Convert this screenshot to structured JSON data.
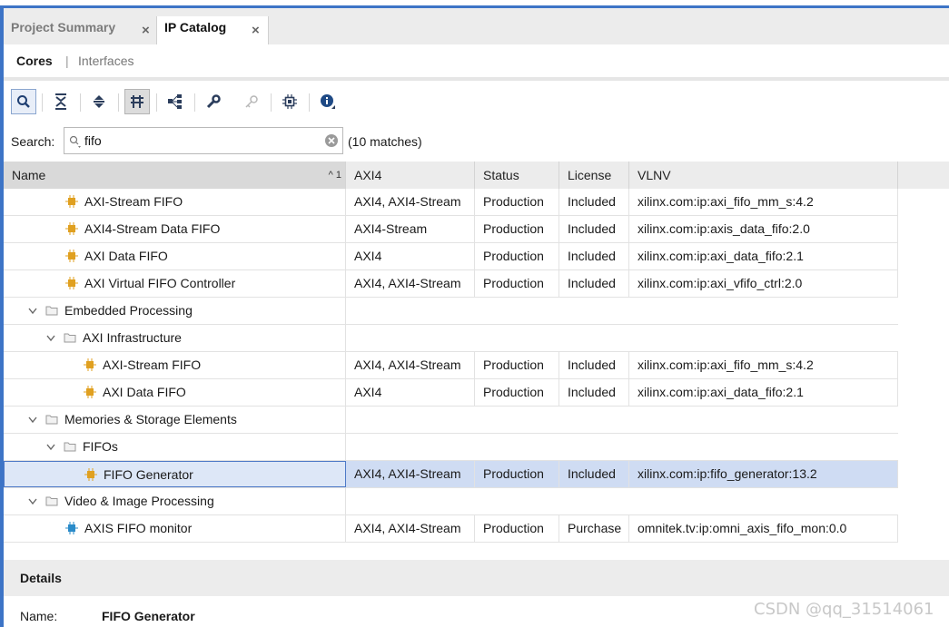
{
  "tabs": [
    {
      "label": "Project Summary",
      "active": false
    },
    {
      "label": "IP Catalog",
      "active": true
    }
  ],
  "tab_close_glyph": "×",
  "subtabs": {
    "cores": "Cores",
    "separator": "|",
    "interfaces": "Interfaces"
  },
  "toolbar": {
    "icons": [
      "search-icon",
      "collapse-all-icon",
      "expand-all-icon",
      "filter-icon",
      "hierarchy-icon",
      "customize-ip-icon",
      "license-key-icon",
      "ip-chip-icon",
      "info-icon"
    ]
  },
  "search": {
    "label": "Search:",
    "value": "fifo",
    "matches": "(10 matches)"
  },
  "columns": [
    "Name",
    "AXI4",
    "Status",
    "License",
    "VLNV"
  ],
  "sort_indicator": "^ 1",
  "rows": [
    {
      "type": "ip",
      "depth": 2,
      "name": "AXI-Stream FIFO",
      "axi4": "AXI4, AXI4-Stream",
      "status": "Production",
      "license": "Included",
      "vlnv": "xilinx.com:ip:axi_fifo_mm_s:4.2"
    },
    {
      "type": "ip",
      "depth": 2,
      "name": "AXI4-Stream Data FIFO",
      "axi4": "AXI4-Stream",
      "status": "Production",
      "license": "Included",
      "vlnv": "xilinx.com:ip:axis_data_fifo:2.0"
    },
    {
      "type": "ip",
      "depth": 2,
      "name": "AXI Data FIFO",
      "axi4": "AXI4",
      "status": "Production",
      "license": "Included",
      "vlnv": "xilinx.com:ip:axi_data_fifo:2.1"
    },
    {
      "type": "ip",
      "depth": 2,
      "name": "AXI Virtual FIFO Controller",
      "axi4": "AXI4, AXI4-Stream",
      "status": "Production",
      "license": "Included",
      "vlnv": "xilinx.com:ip:axi_vfifo_ctrl:2.0"
    },
    {
      "type": "folder",
      "depth": 0,
      "name": "Embedded Processing"
    },
    {
      "type": "folder",
      "depth": 1,
      "name": "AXI Infrastructure"
    },
    {
      "type": "ip",
      "depth": 3,
      "name": "AXI-Stream FIFO",
      "axi4": "AXI4, AXI4-Stream",
      "status": "Production",
      "license": "Included",
      "vlnv": "xilinx.com:ip:axi_fifo_mm_s:4.2"
    },
    {
      "type": "ip",
      "depth": 3,
      "name": "AXI Data FIFO",
      "axi4": "AXI4",
      "status": "Production",
      "license": "Included",
      "vlnv": "xilinx.com:ip:axi_data_fifo:2.1"
    },
    {
      "type": "folder",
      "depth": 0,
      "name": "Memories & Storage Elements"
    },
    {
      "type": "folder",
      "depth": 1,
      "name": "FIFOs"
    },
    {
      "type": "ip",
      "depth": 3,
      "name": "FIFO Generator",
      "axi4": "AXI4, AXI4-Stream",
      "status": "Production",
      "license": "Included",
      "vlnv": "xilinx.com:ip:fifo_generator:13.2",
      "selected": true
    },
    {
      "type": "folder",
      "depth": 0,
      "name": "Video & Image Processing"
    },
    {
      "type": "ip",
      "depth": 2,
      "name": "AXIS FIFO monitor",
      "axi4": "AXI4, AXI4-Stream",
      "status": "Production",
      "license": "Purchase",
      "vlnv": "omnitek.tv:ip:omni_axis_fifo_mon:0.0",
      "thirdparty": true
    }
  ],
  "details": {
    "title": "Details",
    "name_label": "Name:",
    "name_value": "FIFO Generator"
  },
  "watermark": "CSDN @qq_31514061",
  "colors": {
    "accent": "#3d74c6",
    "selection": "#cfdcf3",
    "ip_icon": "#e0a020",
    "thirdparty_icon": "#2a8bc9",
    "info_icon": "#1f4a85"
  }
}
